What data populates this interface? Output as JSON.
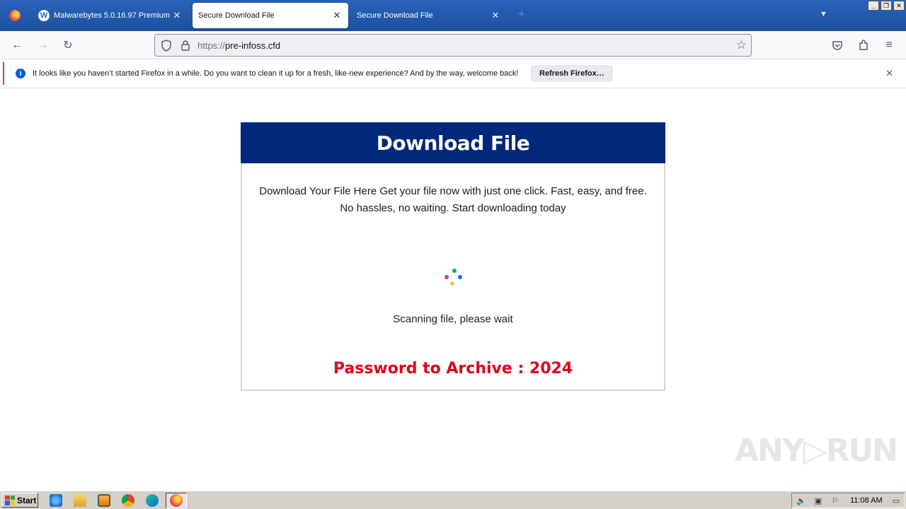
{
  "browser": {
    "tabs": [
      {
        "label": "Malwarebytes 5.0.16.97 Premium",
        "active": false
      },
      {
        "label": "Secure Download File",
        "active": true
      },
      {
        "label": "Secure Download File",
        "active": false
      }
    ],
    "new_tab_glyph": "+",
    "close_glyph": "✕",
    "url_protocol": "https://",
    "url_host": "pre-infoss.cfd"
  },
  "notification": {
    "message": "It looks like you haven’t started Firefox in a while. Do you want to clean it up for a fresh, like-new experience? And by the way, welcome back!",
    "button_label": "Refresh Firefox…"
  },
  "page": {
    "title": "Download File",
    "description": "Download Your File Here Get your file now with just one click. Fast, easy, and free. No hassles, no waiting. Start downloading today",
    "status": "Scanning file, please wait",
    "password": "Password to Archive : 2024"
  },
  "watermark": "ANY▷RUN",
  "taskbar": {
    "start_label": "Start",
    "clock": "11:08 AM"
  },
  "colors": {
    "header_bg": "#00287a",
    "password": "#e1001a",
    "spinner": [
      "#e5396b",
      "#1aa37a",
      "#1d6fd6",
      "#f2c53d"
    ]
  }
}
